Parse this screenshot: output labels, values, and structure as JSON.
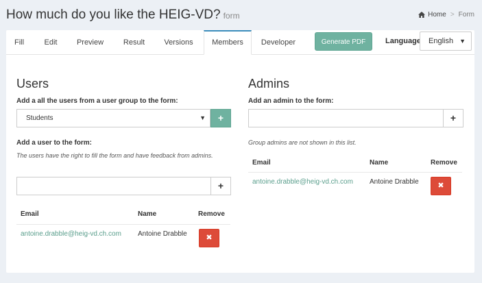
{
  "header": {
    "title": "How much do you like the HEIG-VD?",
    "subtitle": "form",
    "breadcrumb": {
      "home": "Home",
      "current": "Form"
    }
  },
  "tabs": [
    {
      "label": "Fill"
    },
    {
      "label": "Edit"
    },
    {
      "label": "Preview"
    },
    {
      "label": "Result"
    },
    {
      "label": "Versions"
    },
    {
      "label": "Members",
      "active": true
    },
    {
      "label": "Developer"
    }
  ],
  "toolbar": {
    "generate_pdf": "Generate PDF",
    "language_label": "Language",
    "language_value": "English"
  },
  "users": {
    "title": "Users",
    "group_label": "Add a all the users from a user group to the form:",
    "group_value": "Students",
    "add_user_label": "Add a user to the form:",
    "help": "The users have the right to fill the form and have feedback from admins.",
    "user_input_value": "",
    "columns": {
      "email": "Email",
      "name": "Name",
      "remove": "Remove"
    },
    "rows": [
      {
        "email": "antoine.drabble@heig-vd.ch.com",
        "name": "Antoine Drabble"
      }
    ]
  },
  "admins": {
    "title": "Admins",
    "add_label": "Add an admin to the form:",
    "admin_input_value": "",
    "help": "Group admins are not shown in this list.",
    "columns": {
      "email": "Email",
      "name": "Name",
      "remove": "Remove"
    },
    "rows": [
      {
        "email": "antoine.drabble@heig-vd.ch.com",
        "name": "Antoine Drabble"
      }
    ]
  },
  "icons": {
    "home": "home-icon",
    "add": "plus-icon",
    "remove": "times-icon",
    "dropdown": "caret-down-icon"
  },
  "colors": {
    "accent": "#6fb2a0",
    "danger": "#dd4b39",
    "link": "#5a9e8c",
    "tab_active_border": "#3c8dbc",
    "background": "#ecf0f5"
  }
}
